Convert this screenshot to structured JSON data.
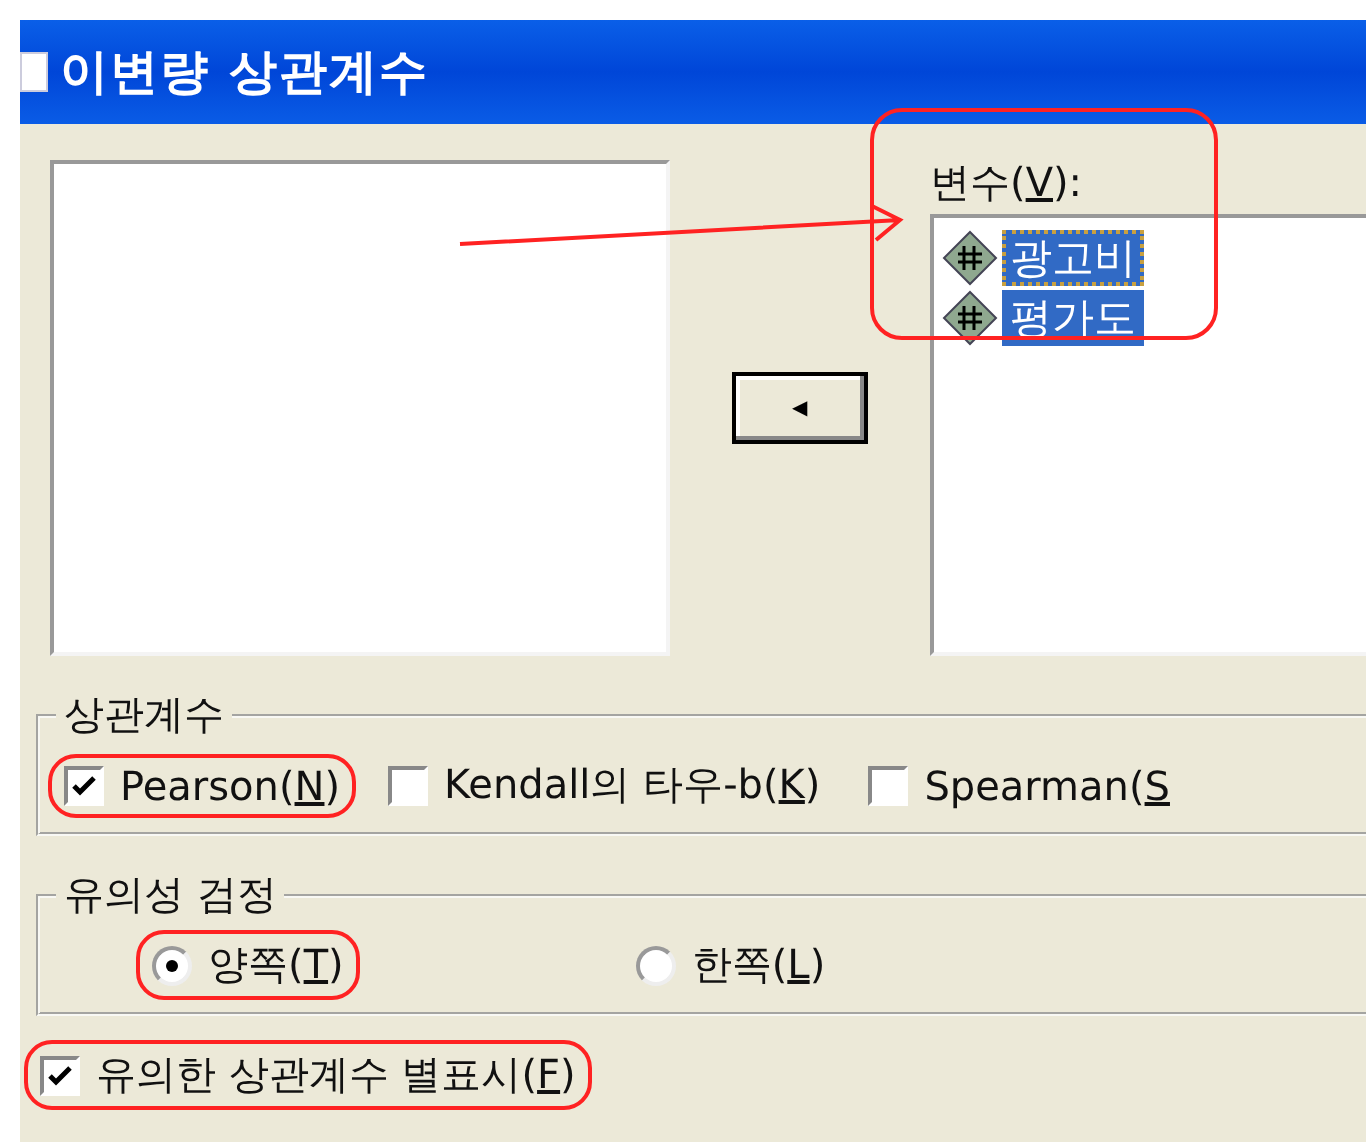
{
  "window": {
    "title": "이변량 상관계수"
  },
  "move_button": {
    "symbol": "◀"
  },
  "variables": {
    "label": {
      "pre": "변수(",
      "key": "V",
      "post": "):"
    },
    "highlighted": true,
    "items": [
      {
        "name": "광고비",
        "selected": true,
        "focused": true
      },
      {
        "name": "평가도",
        "selected": true,
        "focused": false
      }
    ]
  },
  "correlation_group": {
    "title": "상관계수",
    "options": [
      {
        "label": {
          "pre": "Pearson(",
          "key": "N",
          "post": ")"
        },
        "checked": true,
        "highlighted": true
      },
      {
        "label": {
          "pre": "Kendall의 타우-b(",
          "key": "K",
          "post": ")"
        },
        "checked": false,
        "highlighted": false
      },
      {
        "label": {
          "pre": "Spearman(",
          "key": "S"
        },
        "checked": false,
        "highlighted": false
      }
    ]
  },
  "significance_group": {
    "title": "유의성 검정",
    "options": [
      {
        "label": {
          "pre": "양쪽(",
          "key": "T",
          "post": ")"
        },
        "selected": true,
        "highlighted": true
      },
      {
        "label": {
          "pre": "한쪽(",
          "key": "L",
          "post": ")"
        },
        "selected": false,
        "highlighted": false
      }
    ]
  },
  "flag_option": {
    "label": {
      "pre": "유의한 상관계수 별표시(",
      "key": "F",
      "post": ")"
    },
    "checked": true,
    "highlighted": true
  }
}
